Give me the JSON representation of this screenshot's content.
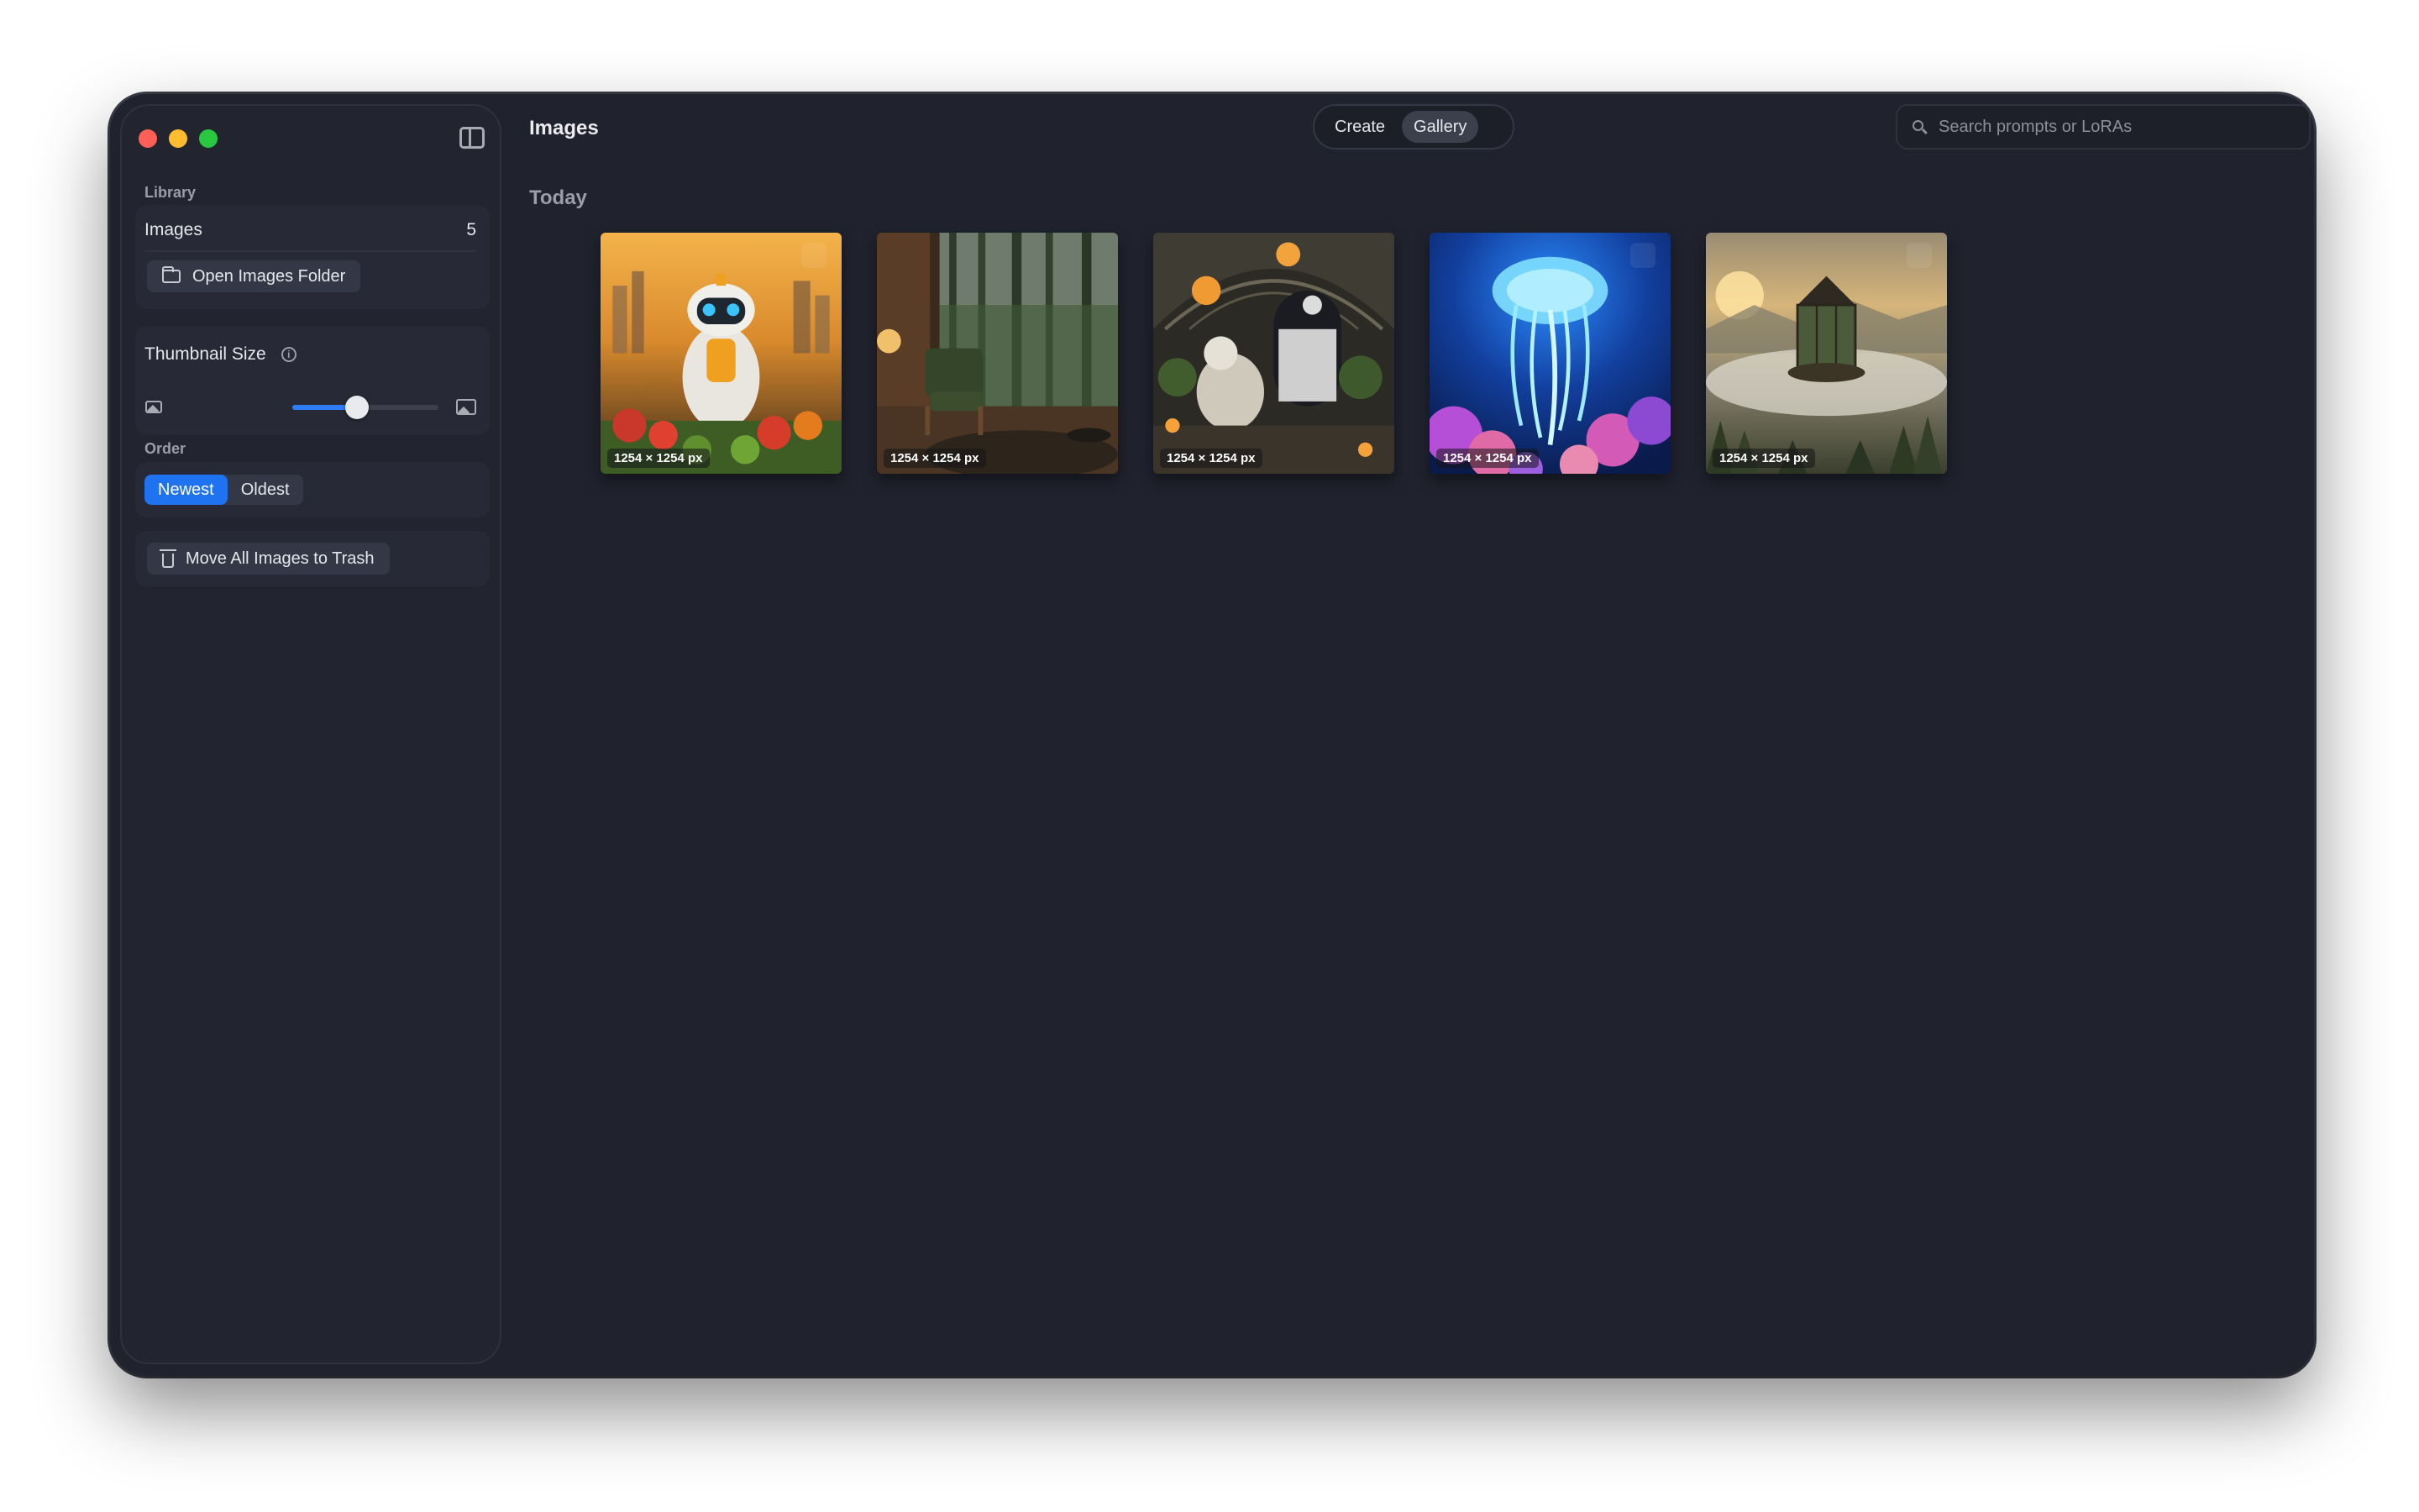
{
  "sidebar": {
    "library_label": "Library",
    "images_label": "Images",
    "images_count": "5",
    "open_folder_label": "Open Images Folder",
    "thumbnail_size_label": "Thumbnail Size",
    "thumbnail_size_value": 0.44,
    "order_label": "Order",
    "order_options": [
      "Newest",
      "Oldest"
    ],
    "order_selected": "Newest",
    "trash_label": "Move All Images to Trash"
  },
  "header": {
    "title": "Images",
    "modes": [
      "Create",
      "Gallery"
    ],
    "active_mode": "Gallery",
    "search_placeholder": "Search prompts or LoRAs"
  },
  "gallery": {
    "group_label": "Today",
    "items": [
      {
        "size": "1254 × 1254 px",
        "subject": "robot-gardener"
      },
      {
        "size": "1254 × 1254 px",
        "subject": "cozy-chair-forest-window"
      },
      {
        "size": "1254 × 1254 px",
        "subject": "astronaut-greenhouse"
      },
      {
        "size": "1254 × 1254 px",
        "subject": "glowing-jellyfish"
      },
      {
        "size": "1254 × 1254 px",
        "subject": "floating-greenhouse"
      }
    ]
  },
  "colors": {
    "window_bg": "#20222e",
    "accent": "#1f73f0"
  }
}
